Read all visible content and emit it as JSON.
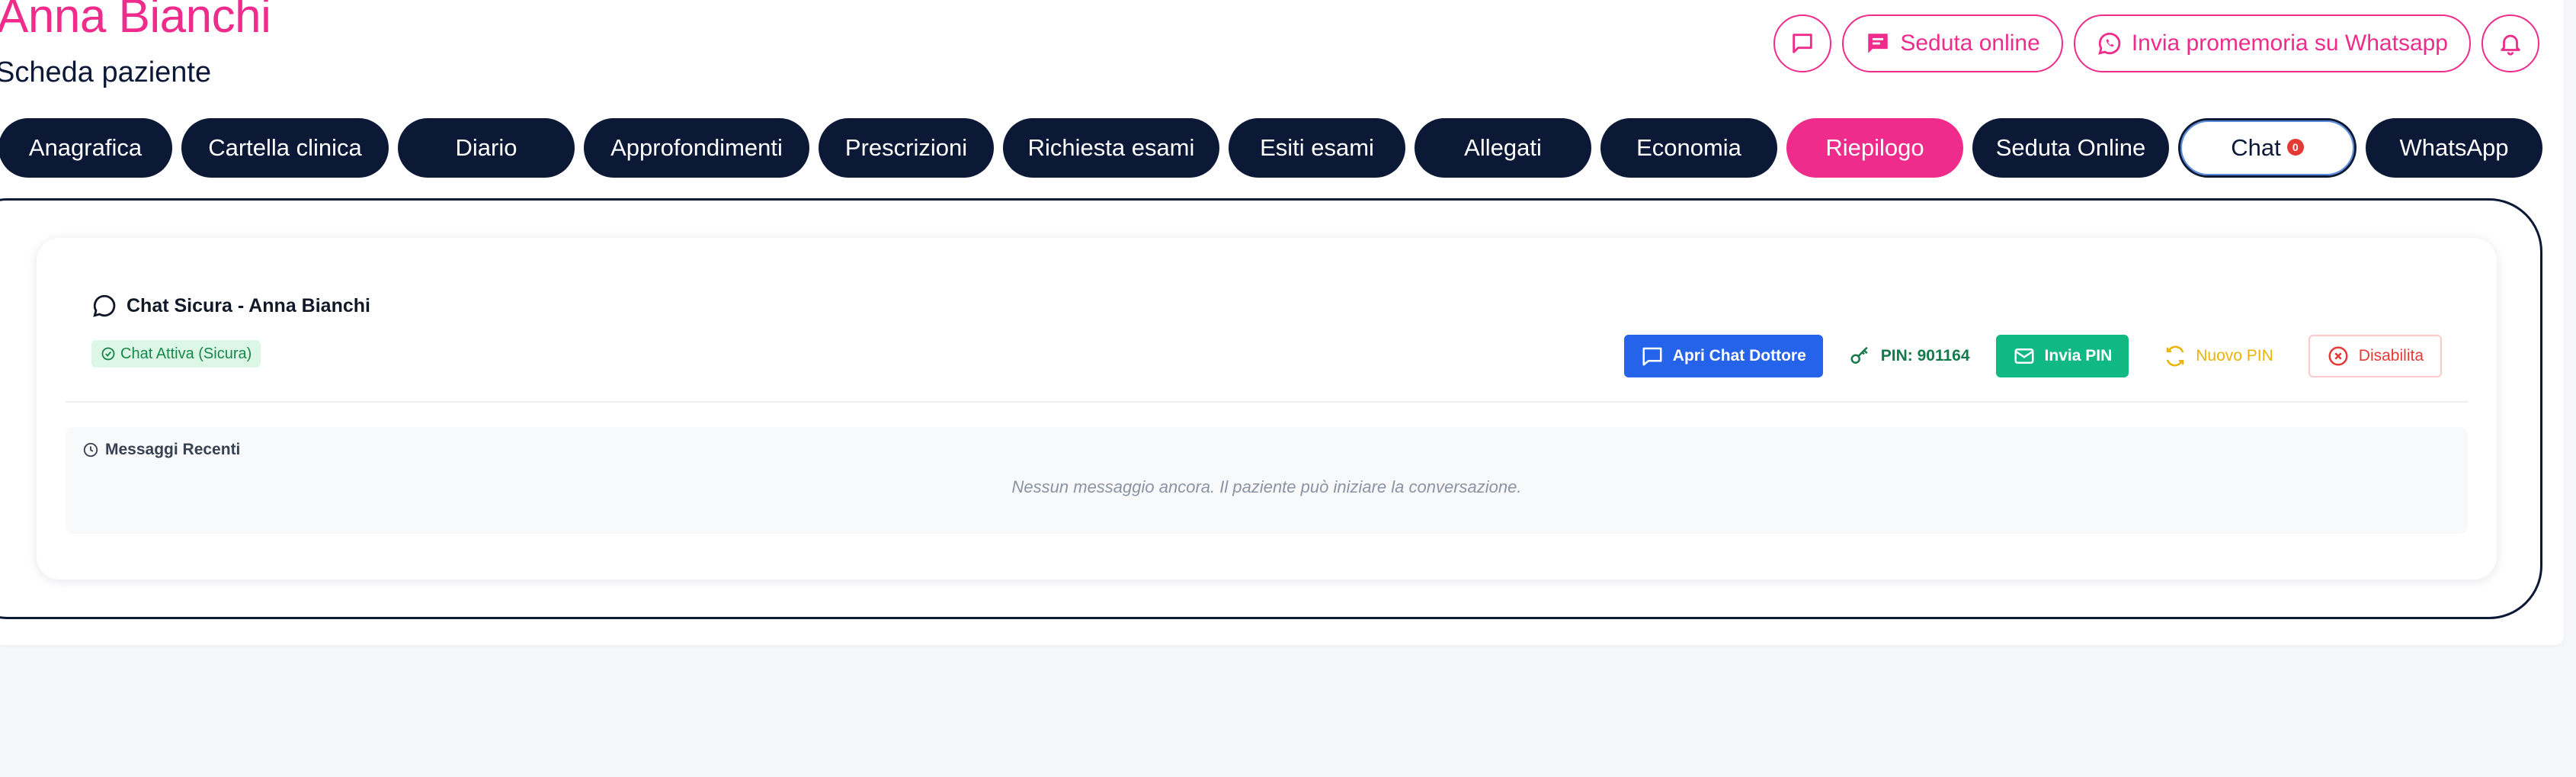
{
  "patient": {
    "name": "Anna Bianchi",
    "subtitle": "Scheda paziente"
  },
  "top_actions": {
    "chat_icon": "chat-bubble-icon",
    "online_session_label": "Seduta online",
    "whatsapp_reminder_label": "Invia promemoria su Whatsapp",
    "bell_icon": "bell-icon"
  },
  "tabs": [
    {
      "label": "Anagrafica",
      "state": "default"
    },
    {
      "label": "Cartella clinica",
      "state": "default"
    },
    {
      "label": "Diario",
      "state": "default"
    },
    {
      "label": "Approfondimenti",
      "state": "default"
    },
    {
      "label": "Prescrizioni",
      "state": "default"
    },
    {
      "label": "Richiesta esami",
      "state": "default"
    },
    {
      "label": "Esiti esami",
      "state": "default"
    },
    {
      "label": "Allegati",
      "state": "default"
    },
    {
      "label": "Economia",
      "state": "default"
    },
    {
      "label": "Riepilogo",
      "state": "highlighted"
    },
    {
      "label": "Seduta Online",
      "state": "default"
    },
    {
      "label": "Chat",
      "state": "selected",
      "badge": "0"
    },
    {
      "label": "WhatsApp",
      "state": "default"
    }
  ],
  "chat_card": {
    "title": "Chat Sicura - Anna Bianchi",
    "status": "Chat Attiva (Sicura)",
    "open_chat_label": "Apri Chat Dottore",
    "pin_label": "PIN: 901164",
    "send_pin_label": "Invia PIN",
    "new_pin_label": "Nuovo PIN",
    "disable_label": "Disabilita",
    "recent_messages_title": "Messaggi Recenti",
    "empty_message": "Nessun messaggio ancora. Il paziente può iniziare la conversazione."
  },
  "colors": {
    "brand_pink": "#ef2b8b",
    "navy": "#0b1836",
    "blue": "#2563eb",
    "green": "#10b981",
    "yellow": "#eab308",
    "red": "#e53935"
  }
}
